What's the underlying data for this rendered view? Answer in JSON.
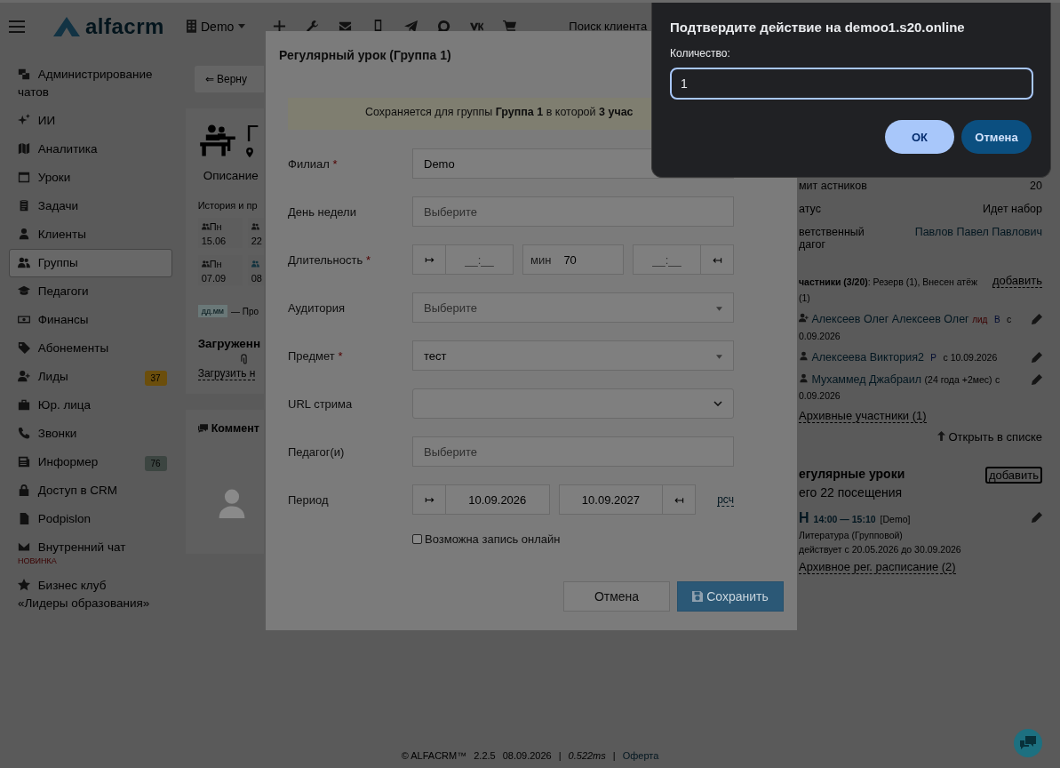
{
  "topbar": {
    "logo": "alfacrm",
    "branch": "Demo",
    "search": {
      "placeholder": "Поиск клиента"
    }
  },
  "sidebar": {
    "items": [
      {
        "label": "Администрирование чатов",
        "selected": false
      },
      {
        "label": "ИИ",
        "selected": false
      },
      {
        "label": "Аналитика",
        "selected": false
      },
      {
        "label": "Уроки",
        "selected": false
      },
      {
        "label": "Задачи",
        "selected": false
      },
      {
        "label": "Клиенты",
        "selected": false
      },
      {
        "label": "Группы",
        "selected": true
      },
      {
        "label": "Педагоги",
        "selected": false
      },
      {
        "label": "Финансы",
        "selected": false
      },
      {
        "label": "Абонементы",
        "selected": false
      },
      {
        "label": "Лиды",
        "selected": false,
        "badge": {
          "text": "37",
          "color": "#6b4e0c"
        }
      },
      {
        "label": "Юр. лица",
        "selected": false
      },
      {
        "label": "Звонки",
        "selected": false
      },
      {
        "label": "Информер",
        "selected": false,
        "badge": {
          "text": "76",
          "color": "#3c4541"
        }
      },
      {
        "label": "Доступ в CRM",
        "selected": false
      },
      {
        "label": "Podpislon",
        "selected": false
      },
      {
        "label": "Внутренний чат",
        "selected": false,
        "note": "НОВИНКА"
      },
      {
        "label": "Бизнес клуб «Лидеры образования»",
        "selected": false
      }
    ]
  },
  "group": {
    "back_button": "⇐ Верну",
    "title": "Г",
    "description": "Описание",
    "history": "История и пр",
    "days": [
      {
        "day": "Пн",
        "date": "15.06"
      },
      {
        "date": "22"
      },
      {
        "day": "Пн",
        "date": "07.09"
      },
      {
        "date": "08"
      }
    ],
    "legend": {
      "badge": "дд.мм",
      "text": "— Про"
    },
    "files_title": "Загруженн",
    "upload_link": "Загрузить н",
    "comments_title": "Коммент"
  },
  "details": [
    {
      "kind": "text",
      "label": "мит астников",
      "value": "20"
    },
    {
      "kind": "text",
      "label": "атус",
      "value": "Идет набор"
    },
    {
      "kind": "link",
      "label": "ветственный дагог",
      "value": "Павлов Павел Павлович"
    }
  ],
  "participants": {
    "title": "**частники (3/20)**: Резерв (1), Внесен атёж (1)",
    "add": "добавить",
    "members": [
      {
        "kind": "lead",
        "name": "Алексеев Олег Алексеев Олег",
        "tag": "лид",
        "status": "В",
        "since": "с 0.09.2026"
      },
      {
        "kind": "client",
        "name": "Алексеева Виктория2",
        "status": "Р",
        "since": "с 10.09.2026"
      },
      {
        "kind": "client",
        "name": "Мухаммед Джабраил",
        "age": "(24 года +2мес)",
        "since": "с 0.09.2026"
      }
    ],
    "archived_link": "Архивные участники (1)",
    "open_list": "Открыть в списке"
  },
  "lessons": {
    "title": "егулярные уроки",
    "add": "добавить",
    "total": "его 22 посещения",
    "items": [
      {
        "day": "Н",
        "time": "14:00 — 15:10",
        "branch": "[Demo]",
        "subject": "Литература (Групповой)",
        "period": "действует с 20.05.2026 до 30.09.2026"
      }
    ],
    "archived_link": "Архивное рег. расписание (2)"
  },
  "modal": {
    "title": "Регулярный урок (Группа 1)",
    "notice": "Сохраняется для группы **Группа 1** в которой **3 учас**",
    "fields": [
      {
        "kind": "select",
        "label": "Филиал",
        "mark": "*",
        "value": "Demo"
      },
      {
        "kind": "select",
        "label": "День недели",
        "placeholder": "Выберите"
      },
      {
        "kind": "duration",
        "label": "Длительность",
        "mark": "*",
        "start_addon": "↦",
        "start": "__:__",
        "minutes_label": "мин",
        "minutes": "70",
        "end": "__:__",
        "end_addon": "↤"
      },
      {
        "kind": "dropdown",
        "label": "Аудитория",
        "placeholder": "Выберите"
      },
      {
        "kind": "dropdown",
        "label": "Предмет",
        "mark": "*",
        "value": "тест"
      },
      {
        "kind": "native",
        "label": "URL стрима"
      },
      {
        "kind": "select",
        "label": "Педагог(и)",
        "placeholder": "Выберите"
      },
      {
        "kind": "period",
        "label": "Период",
        "start_addon": "↦",
        "start": "10.09.2026",
        "end": "10.09.2027",
        "end_addon": "↤",
        "link": "рсч"
      }
    ],
    "online": {
      "label": "Возможна запись онлайн",
      "checked": false
    },
    "buttons": {
      "cancel": "Отмена",
      "save": "Сохранить"
    }
  },
  "dialog": {
    "title": "Подтвердите действие на demoo1.s20.online",
    "label": "Количество:",
    "value": "1",
    "ok": "ОК",
    "cancel": "Отмена"
  },
  "footer": {
    "copyright": "© ALFACRM™",
    "version": "2.2.5",
    "date": "08.09.2026",
    "separator": "|",
    "timing": "0.522ms",
    "link": "Оферта"
  }
}
